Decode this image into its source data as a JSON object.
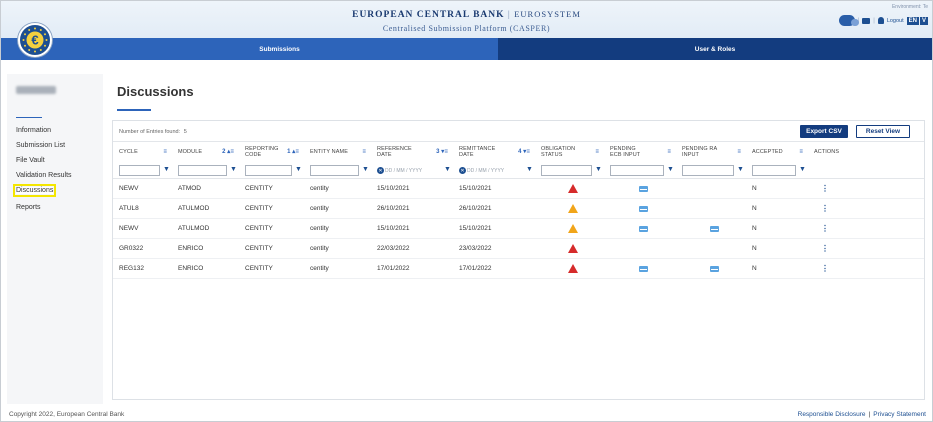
{
  "header": {
    "title_main": "EUROPEAN CENTRAL BANK",
    "title_sep": "|",
    "title_system": "EUROSYSTEM",
    "subtitle": "Centralised Submission Platform (CASPER)",
    "environment_text": "Environment: Te",
    "logout_label": "Logout",
    "lang_selected": "EN",
    "lang_next": "V"
  },
  "nav": {
    "tabs": [
      {
        "label": "Submissions",
        "active": true
      },
      {
        "label": "User & Roles",
        "active": false
      }
    ]
  },
  "sidebar": {
    "items": [
      {
        "label": "Information"
      },
      {
        "label": "Submission List"
      },
      {
        "label": "File Vault"
      },
      {
        "label": "Validation Results"
      },
      {
        "label": "Discussions",
        "highlighted": true
      },
      {
        "label": "Reports"
      }
    ]
  },
  "main": {
    "title": "Discussions",
    "count_label": "Number of Entries found:",
    "count_value": "5",
    "export_label": "Export CSV",
    "reset_label": "Reset View"
  },
  "table": {
    "columns": [
      {
        "label": "CYCLE",
        "sort": "≡"
      },
      {
        "label": "MODULE",
        "sort": "2 ▴≡"
      },
      {
        "label": "REPORTING CODE",
        "sort": "1 ▴≡"
      },
      {
        "label": "ENTITY NAME",
        "sort": "≡"
      },
      {
        "label": "REFERENCE DATE",
        "sort": "3 ▾≡"
      },
      {
        "label": "REMITTANCE DATE",
        "sort": "4 ▾≡"
      },
      {
        "label": "OBLIGATION STATUS",
        "sort": "≡"
      },
      {
        "label": "PENDING ECB INPUT",
        "sort": "≡"
      },
      {
        "label": "PENDING RA INPUT",
        "sort": "≡"
      },
      {
        "label": "ACCEPTED",
        "sort": "≡"
      },
      {
        "label": "ACTIONS",
        "sort": ""
      }
    ],
    "date_placeholder": "DD / MM / YYYY",
    "rows": [
      {
        "cycle": "NEWV",
        "module": "ATMOD",
        "code": "CENTITY",
        "entity": "centity",
        "ref_date": "15/10/2021",
        "rem_date": "15/10/2021",
        "status": "red",
        "ecb": true,
        "ra": false,
        "accepted": "N"
      },
      {
        "cycle": "ATUL8",
        "module": "ATULMOD",
        "code": "CENTITY",
        "entity": "centity",
        "ref_date": "26/10/2021",
        "rem_date": "26/10/2021",
        "status": "orange",
        "ecb": true,
        "ra": false,
        "accepted": "N"
      },
      {
        "cycle": "NEWV",
        "module": "ATULMOD",
        "code": "CENTITY",
        "entity": "centity",
        "ref_date": "15/10/2021",
        "rem_date": "15/10/2021",
        "status": "orange",
        "ecb": true,
        "ra": true,
        "accepted": "N"
      },
      {
        "cycle": "GR0322",
        "module": "ENRICO",
        "code": "CENTITY",
        "entity": "centity",
        "ref_date": "22/03/2022",
        "rem_date": "23/03/2022",
        "status": "red",
        "ecb": false,
        "ra": false,
        "accepted": "N"
      },
      {
        "cycle": "REG132",
        "module": "ENRICO",
        "code": "CENTITY",
        "entity": "centity",
        "ref_date": "17/01/2022",
        "rem_date": "17/01/2022",
        "status": "red",
        "ecb": true,
        "ra": true,
        "accepted": "N"
      }
    ]
  },
  "footer": {
    "copyright": "Copyright 2022, European Central Bank",
    "link1": "Responsible Disclosure",
    "link_sep": "|",
    "link2": "Privacy Statement"
  },
  "colors": {
    "nav_blue": "#2d64ba",
    "nav_dark": "#133c7f",
    "status_red": "#d62b2b",
    "status_orange": "#f1a51a",
    "highlight_yellow": "#f4e600"
  }
}
